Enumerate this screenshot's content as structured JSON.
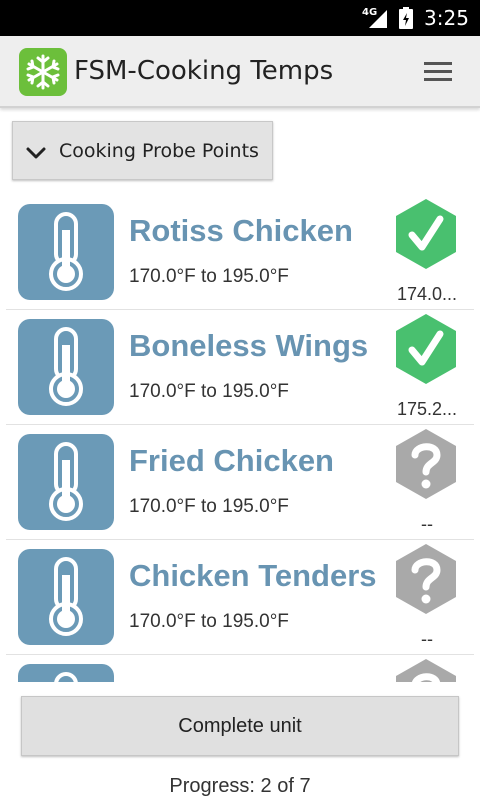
{
  "status_bar": {
    "network": "4G",
    "time": "3:25"
  },
  "app_bar": {
    "title": "FSM-Cooking Temps",
    "icon": "snowflake-icon",
    "menu_icon": "hamburger-menu-icon"
  },
  "dropdown": {
    "label": "Cooking Probe Points",
    "icon": "chevron-down-icon"
  },
  "colors": {
    "accent": "#6894b2",
    "thumb_bg": "#6b9ab7",
    "ok": "#49c06f",
    "unknown": "#a9a9a9",
    "app_icon_bg": "#6cbf3b"
  },
  "items": [
    {
      "title": "Rotiss Chicken",
      "range": "170.0°F to 195.0°F",
      "reading": "174.0...",
      "status": "ok",
      "status_icon": "check-icon"
    },
    {
      "title": "Boneless Wings",
      "range": "170.0°F to 195.0°F",
      "reading": "175.2...",
      "status": "ok",
      "status_icon": "check-icon"
    },
    {
      "title": "Fried Chicken",
      "range": "170.0°F to 195.0°F",
      "reading": "--",
      "status": "unknown",
      "status_icon": "question-icon"
    },
    {
      "title": "Chicken Tenders",
      "range": "170.0°F to 195.0°F",
      "reading": "--",
      "status": "unknown",
      "status_icon": "question-icon"
    },
    {
      "title": "",
      "range": "",
      "reading": "",
      "status": "unknown",
      "status_icon": "question-icon"
    }
  ],
  "complete_button": {
    "label": "Complete unit"
  },
  "progress": {
    "text": "Progress: 2 of 7",
    "done": 2,
    "total": 7
  }
}
